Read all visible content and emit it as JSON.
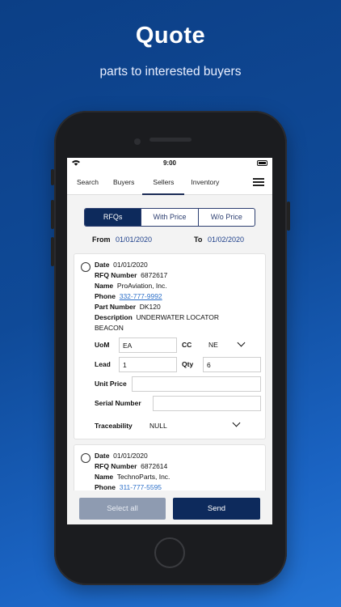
{
  "hero": {
    "title": "Quote",
    "subtitle": "parts to interested buyers"
  },
  "status": {
    "time": "9:00"
  },
  "nav": {
    "tabs": [
      {
        "label": "Search"
      },
      {
        "label": "Buyers"
      },
      {
        "label": "Sellers",
        "active": true
      },
      {
        "label": "Inventory"
      }
    ]
  },
  "segments": [
    {
      "label": "RFQs",
      "active": true
    },
    {
      "label": "With Price"
    },
    {
      "label": "W/o Price"
    }
  ],
  "filter": {
    "from_label": "From",
    "from_value": "01/01/2020",
    "to_label": "To",
    "to_value": "01/02/2020"
  },
  "cards": [
    {
      "date_label": "Date",
      "date": "01/01/2020",
      "rfq_label": "RFQ Number",
      "rfq": "6872617",
      "name_label": "Name",
      "name": "ProAviation, Inc.",
      "phone_label": "Phone",
      "phone": "332-777-9992",
      "part_label": "Part Number",
      "part": "DK120",
      "desc_label": "Description",
      "desc_line1": "UNDERWATER LOCATOR",
      "desc_line2": "BEACON",
      "uom_label": "UoM",
      "uom": "EA",
      "cc_label": "CC",
      "cc": "NE",
      "lead_label": "Lead",
      "lead": "1",
      "qty_label": "Qty",
      "qty": "6",
      "unit_price_label": "Unit Price",
      "unit_price": "",
      "serial_label": "Serial Number",
      "serial": "",
      "trace_label": "Traceability",
      "trace": "NULL"
    },
    {
      "date_label": "Date",
      "date": "01/01/2020",
      "rfq_label": "RFQ Number",
      "rfq": "6872614",
      "name_label": "Name",
      "name": "TechnoParts, Inc.",
      "phone_label": "Phone",
      "phone": "311-777-5595"
    }
  ],
  "actions": {
    "select_all": "Select all",
    "send": "Send"
  },
  "colors": {
    "primary": "#0d2a5c",
    "link": "#2d70c9",
    "disabled": "#8e9bb1"
  }
}
